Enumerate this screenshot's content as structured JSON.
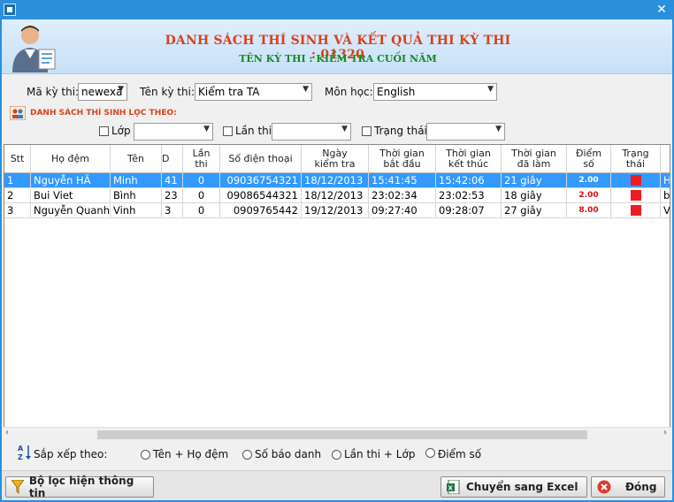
{
  "header": {
    "title": "DANH SÁCH THÍ SINH VÀ KẾT QUẢ THI KỲ THI : 01320",
    "subtitle": "TÊN KỲ THI : KIỂM TRA CUỐI NĂM"
  },
  "selectors": {
    "ma_ky_thi_label": "Mã kỳ thi:",
    "ma_ky_thi_value": "newexa",
    "ten_ky_thi_label": "Tên kỳ thi:",
    "ten_ky_thi_value": "Kiểm tra TA",
    "mon_hoc_label": "Môn học:",
    "mon_hoc_value": "English"
  },
  "filter": {
    "title": "DANH SÁCH THÍ SINH LỌC THEO:",
    "lop_label": "Lớp",
    "lan_thi_label": "Lần thi",
    "trang_thai_label": "Trạng thái"
  },
  "table": {
    "headers": {
      "stt": "Stt",
      "ho_dem": "Họ đệm",
      "ten": "Tên",
      "id": "D",
      "lan_thi": "Lần thi",
      "so_dien_thoai": "Số điện thoại",
      "ngay_kiem_tra": "Ngày kiểm tra",
      "bat_dau": "Thời gian bắt đầu",
      "ket_thuc": "Thời gian kết thúc",
      "da_lam": "Thời gian đã làm",
      "diem_so": "Điểm số",
      "trang_thai": "Trạng thái"
    },
    "rows": [
      {
        "stt": "1",
        "ho_dem": "Nguyễn HÃ",
        "ten": "Minh",
        "id": "41",
        "lan_thi": "0",
        "phone": "09036754321",
        "ngay": "18/12/2013",
        "bat_dau": "15:41:45",
        "ket_thuc": "15:42:06",
        "da_lam": "21 giây",
        "diem": "2.00",
        "extra": "H"
      },
      {
        "stt": "2",
        "ho_dem": "Bui Viet",
        "ten": "Bình",
        "id": "23",
        "lan_thi": "0",
        "phone": "09086544321",
        "ngay": "18/12/2013",
        "bat_dau": "23:02:34",
        "ket_thuc": "23:02:53",
        "da_lam": "18 giây",
        "diem": "2.00",
        "extra": "b"
      },
      {
        "stt": "3",
        "ho_dem": "Nguyễn Quanh",
        "ten": "Vinh",
        "id": "3",
        "lan_thi": "0",
        "phone": "0909765442",
        "ngay": "19/12/2013",
        "bat_dau": "09:27:40",
        "ket_thuc": "09:28:07",
        "da_lam": "27 giây",
        "diem": "8.00",
        "extra": "V"
      }
    ]
  },
  "sort": {
    "label": "Sắp xếp theo:",
    "opt1": "Tên + Họ đệm",
    "opt2": "Số báo danh",
    "opt3": "Lần thi + Lớp",
    "opt4": "Điểm số"
  },
  "buttons": {
    "filter": "Bộ lọc hiện thông tin",
    "excel": "Chuyển sang Excel",
    "close": "Đóng"
  },
  "colors": {
    "title": "#d9411c",
    "subtitle": "#158a1e",
    "selection": "#3399ff",
    "status_red": "#ec1c24"
  }
}
